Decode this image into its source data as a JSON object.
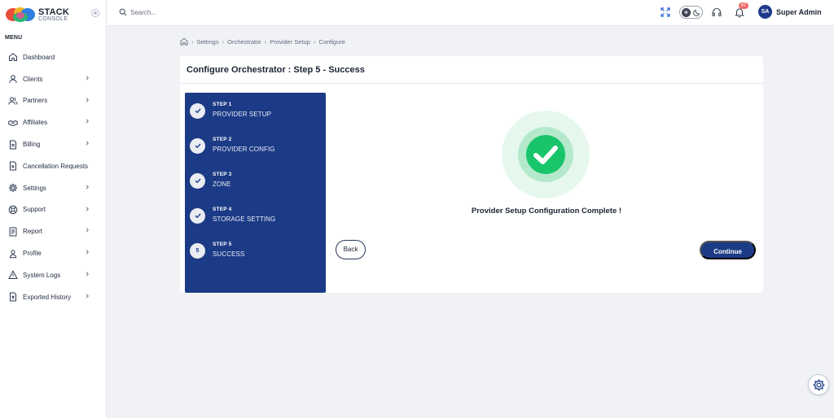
{
  "app": {
    "brand_main": "STACK",
    "brand_sub": "CONSOLE",
    "accent_color": "#1c3b86"
  },
  "sidebar": {
    "menu_title": "MENU",
    "items": [
      {
        "label": "Dashboard",
        "icon": "home-icon",
        "has_submenu": false
      },
      {
        "label": "Clients",
        "icon": "user-icon",
        "has_submenu": true
      },
      {
        "label": "Partners",
        "icon": "users-icon",
        "has_submenu": true
      },
      {
        "label": "Affiliates",
        "icon": "handshake-icon",
        "has_submenu": true
      },
      {
        "label": "Billing",
        "icon": "document-icon",
        "has_submenu": true
      },
      {
        "label": "Cancellation Requests",
        "icon": "cancel-doc-icon",
        "has_submenu": false
      },
      {
        "label": "Settings",
        "icon": "gear-icon",
        "has_submenu": true
      },
      {
        "label": "Support",
        "icon": "support-icon",
        "has_submenu": true
      },
      {
        "label": "Report",
        "icon": "report-icon",
        "has_submenu": true
      },
      {
        "label": "Profile",
        "icon": "profile-icon",
        "has_submenu": true
      },
      {
        "label": "System Logs",
        "icon": "warning-icon",
        "has_submenu": true
      },
      {
        "label": "Exported History",
        "icon": "export-icon",
        "has_submenu": true
      }
    ]
  },
  "topbar": {
    "search_placeholder": "Search...",
    "notification_count": "47",
    "user_initials": "SA",
    "user_name": "Super Admin"
  },
  "breadcrumb": [
    "Settings",
    "Orchestrator",
    "Provider Setup",
    "Configure"
  ],
  "page": {
    "title": "Configure Orchestrator : Step 5 - Success",
    "steps": [
      {
        "number_label": "STEP 1",
        "name": "PROVIDER SETUP",
        "status": "done",
        "marker": ""
      },
      {
        "number_label": "STEP 2",
        "name": "PROVIDER CONFIG",
        "status": "done",
        "marker": ""
      },
      {
        "number_label": "STEP 3",
        "name": "ZONE",
        "status": "done",
        "marker": ""
      },
      {
        "number_label": "STEP 4",
        "name": "STORAGE SETTING",
        "status": "done",
        "marker": ""
      },
      {
        "number_label": "STEP 5",
        "name": "SUCCESS",
        "status": "current",
        "marker": "5"
      }
    ],
    "success_message": "Provider Setup Configuration Complete !",
    "back_label": "Back",
    "continue_label": "Continue"
  }
}
